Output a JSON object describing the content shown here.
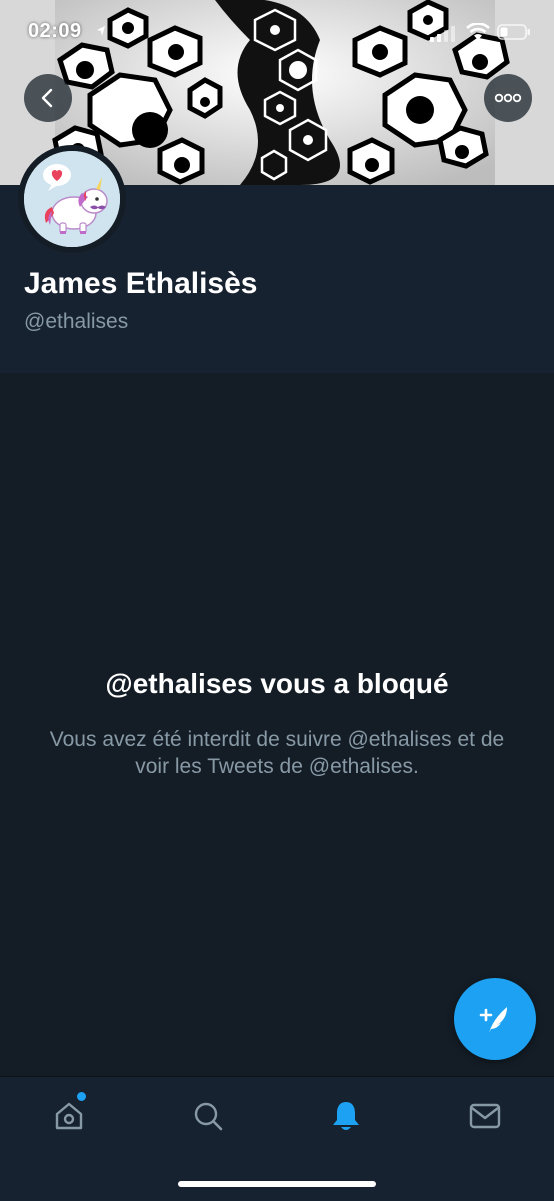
{
  "status_bar": {
    "time": "02:09",
    "icons": [
      "location-arrow-icon",
      "signal-icon",
      "wifi-icon",
      "battery-icon"
    ]
  },
  "header": {
    "back_icon": "chevron-left-icon",
    "more_icon": "more-horizontal-icon"
  },
  "profile": {
    "display_name": "James Ethalisès",
    "handle": "@ethalises",
    "avatar": "unicorn-avatar"
  },
  "blocked": {
    "title": "@ethalises vous a bloqué",
    "description": "Vous avez été interdit de suivre @ethalises et de voir les Tweets de @ethalises."
  },
  "compose": {
    "icon": "compose-tweet-icon"
  },
  "tab_bar": {
    "tabs": [
      {
        "name": "home",
        "icon": "home-icon",
        "active": false,
        "badge": true
      },
      {
        "name": "search",
        "icon": "search-icon",
        "active": false,
        "badge": false
      },
      {
        "name": "notifications",
        "icon": "bell-icon",
        "active": true,
        "badge": false
      },
      {
        "name": "messages",
        "icon": "mail-icon",
        "active": false,
        "badge": false
      }
    ]
  },
  "colors": {
    "background": "#141d26",
    "header_background": "#172231",
    "accent": "#1da1f2",
    "secondary_text": "#8899a6"
  }
}
